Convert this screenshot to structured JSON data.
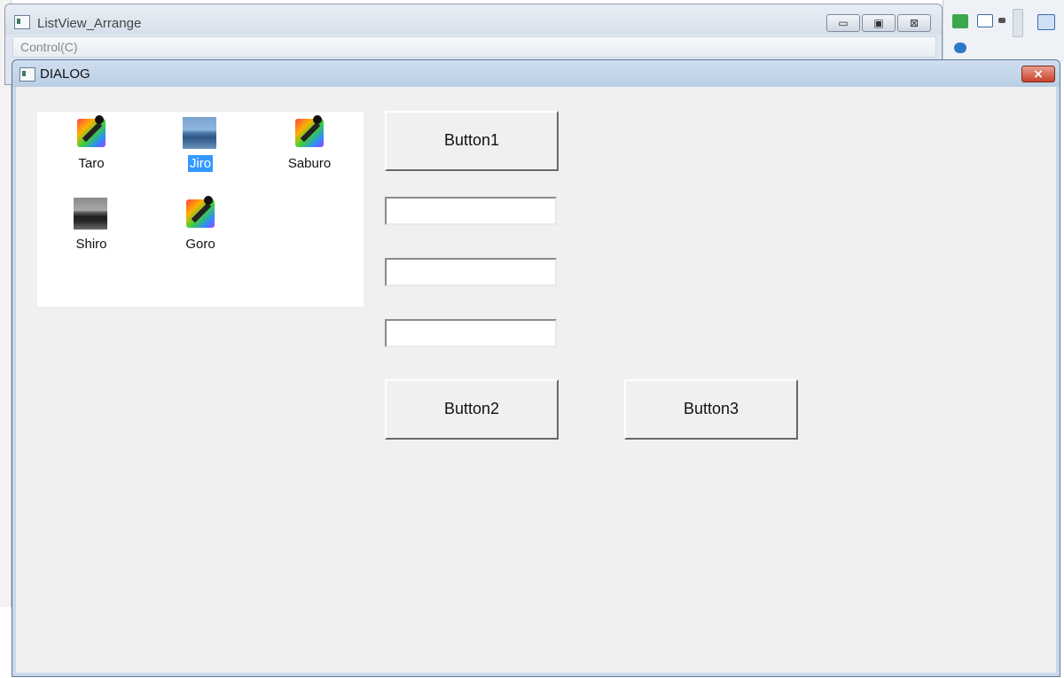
{
  "background_window": {
    "title": "ListView_Arrange",
    "menu": [
      "Control(C)"
    ],
    "caption_buttons": [
      "minimize",
      "maximize",
      "close"
    ]
  },
  "dialog": {
    "title": "DIALOG",
    "close_label": "×"
  },
  "listview": {
    "items": [
      {
        "label": "Taro",
        "icon": "paint-brush-icon",
        "selected": false
      },
      {
        "label": "Jiro",
        "icon": "car-photo-icon",
        "selected": true
      },
      {
        "label": "Saburo",
        "icon": "paint-brush-icon",
        "selected": false
      },
      {
        "label": "Shiro",
        "icon": "car-photo-icon",
        "selected": false
      },
      {
        "label": "Goro",
        "icon": "paint-brush-icon",
        "selected": false
      }
    ]
  },
  "buttons": {
    "button1": "Button1",
    "button2": "Button2",
    "button3": "Button3"
  },
  "edits": {
    "edit1": "",
    "edit2": "",
    "edit3": ""
  },
  "colors": {
    "selection": "#3399ff",
    "dialog_client": "#f0f0f0",
    "close_button": "#c8412b"
  }
}
